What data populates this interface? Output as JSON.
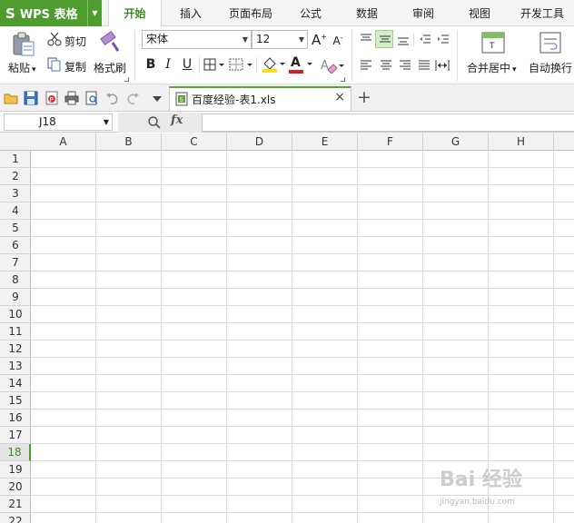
{
  "app": {
    "logo_letter": "S",
    "logo_title": "WPS 表格",
    "dropdown_arrow": "▼"
  },
  "menu": {
    "tabs": [
      {
        "label": "开始",
        "active": true
      },
      {
        "label": "插入"
      },
      {
        "label": "页面布局"
      },
      {
        "label": "公式"
      },
      {
        "label": "数据"
      },
      {
        "label": "审阅"
      },
      {
        "label": "视图"
      },
      {
        "label": "开发工具"
      }
    ]
  },
  "ribbon": {
    "clipboard": {
      "paste": "粘贴",
      "cut": "剪切",
      "copy": "复制",
      "format_painter": "格式刷",
      "dropdown": "▾"
    },
    "font": {
      "name": "宋体",
      "size": "12",
      "grow": "A",
      "shrink": "A",
      "bold": "B",
      "italic": "I",
      "underline": "U",
      "color_letter": "A"
    },
    "alignment": {
      "merge_center": "合并居中",
      "wrap_text": "自动换行"
    }
  },
  "document": {
    "tab_name": "百度经验-表1.xls",
    "close": "×",
    "new_tab": "+"
  },
  "formula_bar": {
    "cell_ref": "J18",
    "fx_label": "fx",
    "value": ""
  },
  "grid": {
    "columns": [
      "A",
      "B",
      "C",
      "D",
      "E",
      "F",
      "G",
      "H"
    ],
    "rows": [
      "1",
      "2",
      "3",
      "4",
      "5",
      "6",
      "7",
      "8",
      "9",
      "10",
      "11",
      "12",
      "13",
      "14",
      "15",
      "16",
      "17",
      "18",
      "19",
      "20",
      "21",
      "22"
    ],
    "selected_row": "18"
  },
  "watermark": {
    "brand": "Bai 经验",
    "url": "jingyan.baidu.com"
  },
  "colors": {
    "accent": "#4c9c2e",
    "active_tab_text": "#3a8c22",
    "font_color_bar": "#d42020",
    "fill_color_bar": "#f6e21a"
  }
}
